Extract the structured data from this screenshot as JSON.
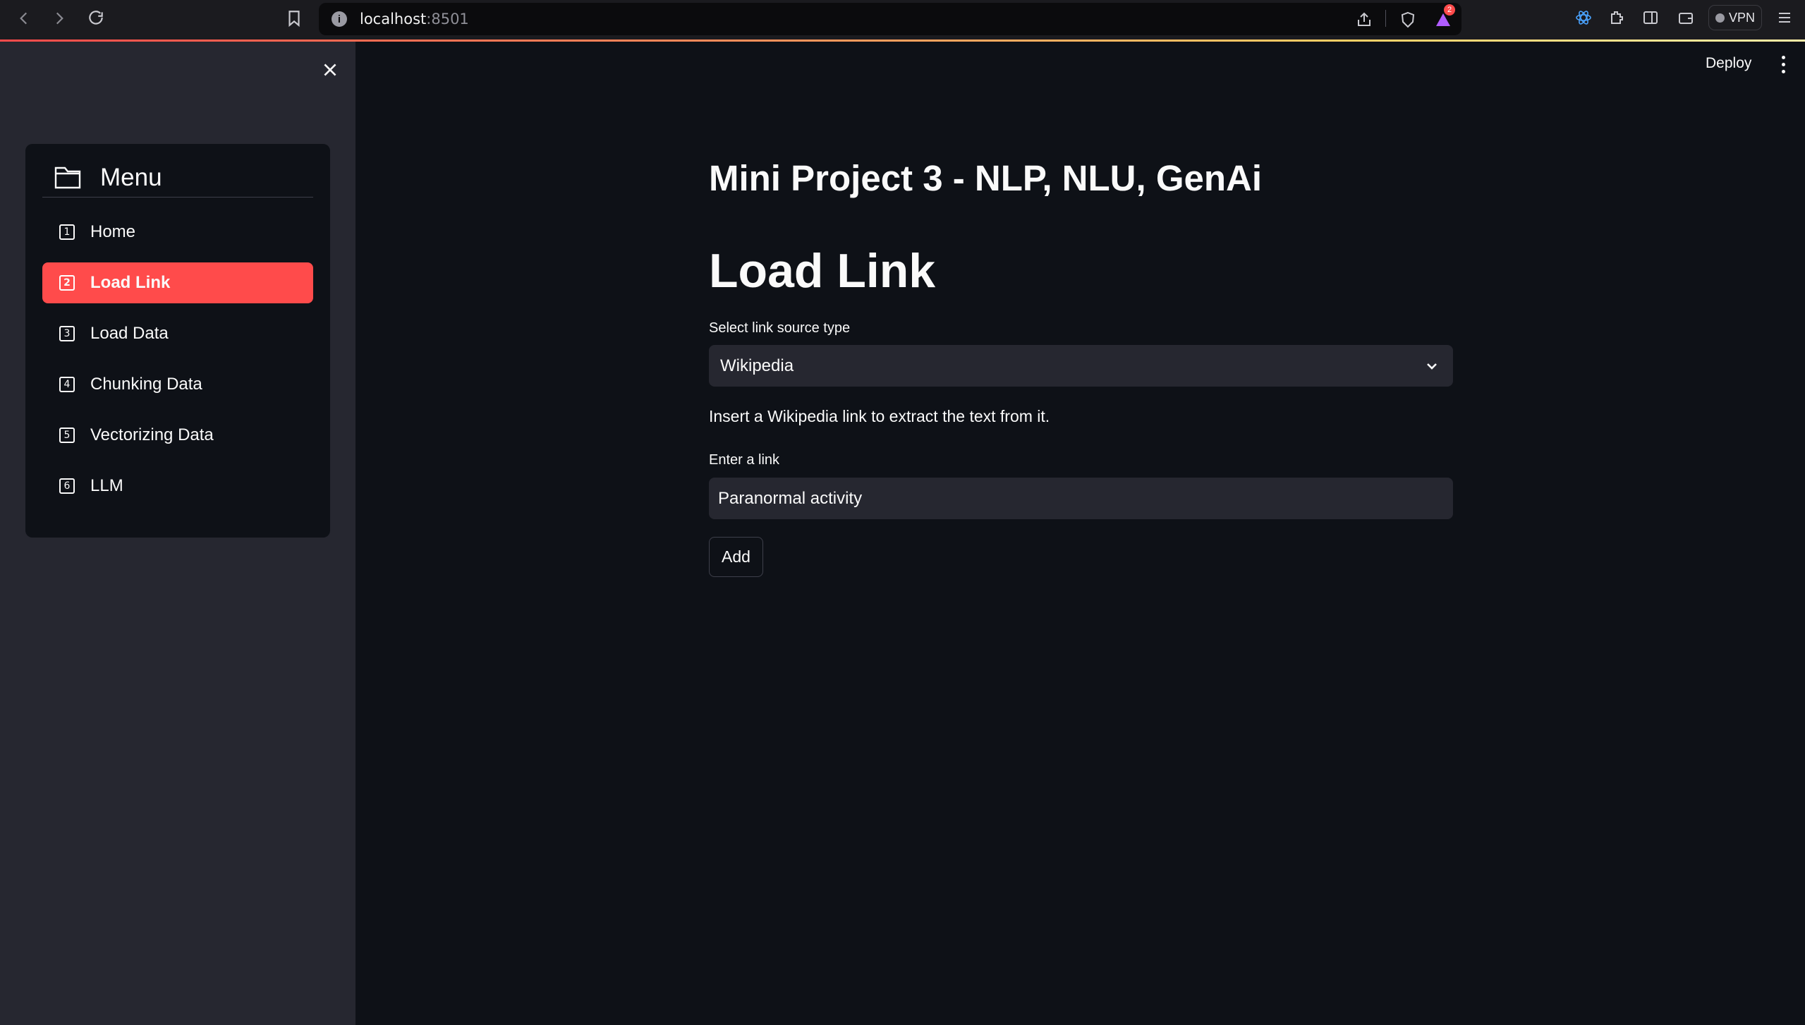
{
  "browser": {
    "url_host": "localhost",
    "url_port": ":8501",
    "notification_count": "2",
    "vpn_label": "VPN"
  },
  "sidebar": {
    "menu_title": "Menu",
    "items": [
      {
        "num": "1",
        "label": "Home"
      },
      {
        "num": "2",
        "label": "Load Link",
        "active": true
      },
      {
        "num": "3",
        "label": "Load Data"
      },
      {
        "num": "4",
        "label": "Chunking Data"
      },
      {
        "num": "5",
        "label": "Vectorizing Data"
      },
      {
        "num": "6",
        "label": "LLM"
      }
    ]
  },
  "header": {
    "deploy_label": "Deploy"
  },
  "main": {
    "app_title": "Mini Project 3 - NLP, NLU, GenAi",
    "page_title": "Load Link",
    "select_label": "Select link source type",
    "select_value": "Wikipedia",
    "info_text": "Insert a Wikipedia link to extract the text from it.",
    "link_label": "Enter a link",
    "link_value": "Paranormal activity",
    "add_label": "Add"
  },
  "colors": {
    "accent": "#ff4b4b",
    "background": "#0e1117",
    "sidebar": "#262730"
  }
}
